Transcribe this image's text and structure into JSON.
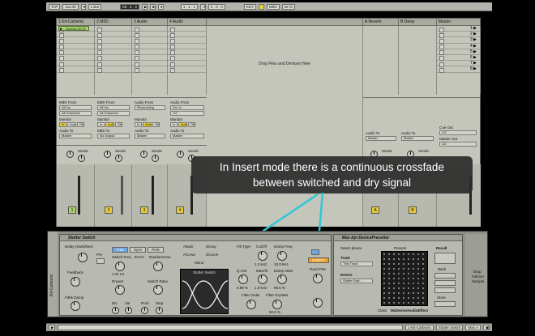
{
  "transport": {
    "tap": "TAP",
    "tempo": "111.00",
    "bar": "1 Bar",
    "position": "59 . 2 . 3",
    "position2": "1 . 1 . 1",
    "loop": "4 . 0 . 0",
    "key": "KEY",
    "midi": "MIDI",
    "cpu": "26 %"
  },
  "tracks": [
    {
      "name": "1 Kit-Carbonic",
      "clip": "Synced Kit 02",
      "num": "1",
      "input_type_label": "MIDI From",
      "input_type": "All Ins",
      "channel": "All Channels",
      "monitor_label": "Monitor",
      "monitor_in": "In",
      "monitor_auto": "Auto",
      "monitor_off": "Off",
      "output_label": "Audio To",
      "output": "Master",
      "sends_label": "Sends"
    },
    {
      "name": "2 MIDI",
      "num": "2",
      "input_type_label": "MIDI From",
      "input_type": "All Ins",
      "channel": "All Channels",
      "monitor_label": "Monitor",
      "monitor_in": "In",
      "monitor_auto": "Auto",
      "monitor_off": "Off",
      "output_label": "MIDI To",
      "output": "No Output",
      "sends_label": "Sends"
    },
    {
      "name": "3 Audio",
      "num": "3",
      "input_type_label": "Audio From",
      "input_type": "Resampling",
      "channel": "",
      "monitor_label": "Monitor",
      "monitor_in": "In",
      "monitor_auto": "Auto",
      "monitor_off": "Off",
      "output_label": "Audio To",
      "output": "Master",
      "sends_label": "Sends"
    },
    {
      "name": "4 Audio",
      "num": "4",
      "input_type_label": "Audio From",
      "input_type": "Ext. In",
      "channel": "1/2",
      "monitor_label": "Monitor",
      "monitor_in": "In",
      "monitor_auto": "Auto",
      "monitor_off": "Off",
      "output_label": "Audio To",
      "output": "Master",
      "sends_label": "Sends"
    }
  ],
  "drop_zone": "Drop Files and Devices Here",
  "returns": [
    {
      "name": "A Reverb",
      "num": "A",
      "output_label": "Audio To",
      "output": "Master",
      "sends_label": "Sends"
    },
    {
      "name": "B Delay",
      "num": "B",
      "output_label": "Audio To",
      "output": "Master",
      "sends_label": "Sends"
    }
  ],
  "master": {
    "name": "Master",
    "cue_label": "Cue Out",
    "cue": "1/2",
    "out_label": "Master Out",
    "out": "1/2"
  },
  "scenes": [
    "1",
    "2",
    "3",
    "4",
    "5",
    "6",
    "7",
    "8"
  ],
  "caption": {
    "line1": "In Insert mode there is a continuous crossfade",
    "line2": "between switched and dry signal"
  },
  "device_stutter": {
    "title": "Stutter Switch",
    "delay_label": "Delay (Switchlen)",
    "pre": "Pre",
    "modes": [
      "Free",
      "Sync",
      "Prob"
    ],
    "switch_freq": "Switch Freq",
    "env_pct": "Env%",
    "randomness": "Randomness",
    "feedback": "Feedback",
    "drywet_label": "Drywet",
    "switch_ratio": "Switch Ratio",
    "fdbk_damp": "Fdbk Damp",
    "val_121": "1.21 Hz",
    "val_pct": "20.0 %",
    "attack": "Attack",
    "decay": "Decay",
    "acurve": "ACurve",
    "dcurve": "DCurve",
    "mirror": "Mirror",
    "div": "Div",
    "var": "Var",
    "prob": "Prob",
    "stop": "Stop",
    "envelope_title": "Stutter Switch",
    "filt_type": "Filt Type",
    "cutoff": "CutOff",
    "damp_freq": "Damp Freq",
    "q_amt": "Q Amt",
    "mixfilt": "MaxFilt",
    "damp_atten": "Damp Atten",
    "filter_order": "Filter Order",
    "filter_drywet": "Filter Dry/Wet",
    "send_pan": "Rand Pan",
    "insert": "INSERT",
    "hz1": "1.3 kHz",
    "hz2": "1.9 kHz",
    "hz3": "10.0 kHz",
    "pct1": "0.89 %",
    "pct2": "96.5 %",
    "pct3": "50.0 %"
  },
  "device_presetter": {
    "title": "Max Api DevicePresetter",
    "select_device": "Select device",
    "track_label": "Track",
    "track": "This Track",
    "device_label": "Device",
    "device": "Stutter Swit...",
    "presets_label": "Presets",
    "recall": "Recall",
    "store": "Store",
    "bank": "Bank",
    "class_label": "Class",
    "class_value": "MxDeviceAudioEffect",
    "sidebar_text": [
      "Drop",
      "Instrum",
      "Sample"
    ]
  },
  "left_device_label": "Kit-Carbonic",
  "bottom_bar": {
    "track_label": "1-Kit-Carbonic",
    "device1": "Stutter Switch",
    "device2": "Max A"
  }
}
